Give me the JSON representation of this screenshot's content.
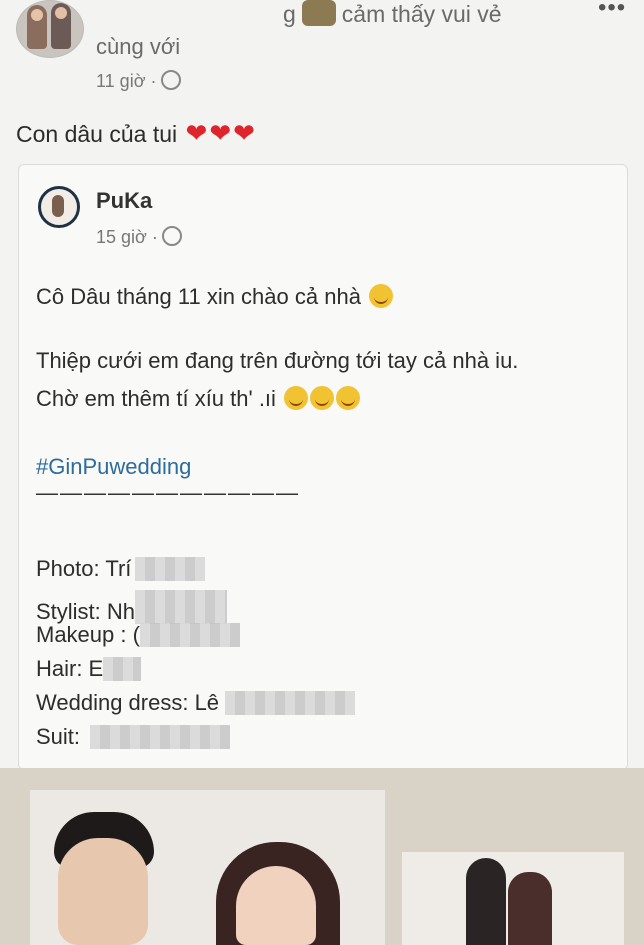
{
  "post": {
    "header_prefix": "g",
    "feeling": "cảm thấy vui vẻ",
    "with": "cùng với",
    "time": "11 giờ ·",
    "more": "•••",
    "caption": "Con dâu của tui",
    "hearts": [
      "❤",
      "❤",
      "❤"
    ]
  },
  "shared": {
    "author": "PuKa",
    "time": "15 giờ ·",
    "line1": "Cô Dâu tháng 11 xin chào cả nhà",
    "line2": "Thiệp cưới em đang trên đường tới tay cả nhà iu.",
    "line3": "Chờ em thêm tí xíu th' .ıi",
    "hashtag": "#GinPuwedding",
    "dashes": "———————————",
    "credits": {
      "photo": "Photo: Trí",
      "stylist": "Stylist: Nh",
      "makeup": "Makeup : (",
      "hair": "Hair: E",
      "dress": "Wedding dress: Lê",
      "suit": "Suit:"
    }
  },
  "colors": {
    "heart": "#e0242b",
    "hashtag": "#2e6b9e",
    "background": "#f3f3f1"
  },
  "icons": [
    "globe-icon",
    "more-icon",
    "heart-icon",
    "emoji-icon"
  ]
}
